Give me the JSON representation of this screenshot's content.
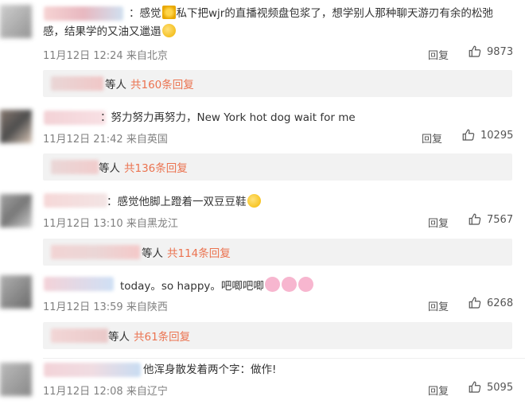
{
  "comments": [
    {
      "text_line1": "：感觉",
      "text_line1b": "私下把wjr的直播视频盘包浆了，想学别人那种聊天游刃有余的松弛",
      "text_line2": "感，结果学的又油又邋遢",
      "time": "11月12日 12:24 来自北京",
      "reply_label": "回复",
      "likes": "9873",
      "thread_suffix": "等人",
      "thread_link": "共160条回复"
    },
    {
      "text": "：努力努力再努力，New York hot dog wait for me",
      "time": "11月12日 21:42 来自英国",
      "reply_label": "回复",
      "likes": "10295",
      "thread_suffix": "等人",
      "thread_link": "共136条回复"
    },
    {
      "text": "：感觉他脚上蹬着一双豆豆鞋",
      "time": "11月12日 13:10 来自黑龙江",
      "reply_label": "回复",
      "likes": "7567",
      "thread_suffix": "等人",
      "thread_link": "共114条回复"
    },
    {
      "text": "today。so happy。吧唧吧唧",
      "time": "11月12日 13:59 来自陕西",
      "reply_label": "回复",
      "likes": "6268",
      "thread_suffix": "等人",
      "thread_link": "共61条回复"
    },
    {
      "text": "他浑身散发着两个字：做作!",
      "time": "11月12日 12:08 来自辽宁",
      "reply_label": "回复",
      "likes": "5095"
    }
  ],
  "colors": {
    "link": "#eb7350",
    "meta": "#808080",
    "reply_bg": "#f2f2f2"
  },
  "icons": {
    "like": "thumbs-up-icon"
  }
}
